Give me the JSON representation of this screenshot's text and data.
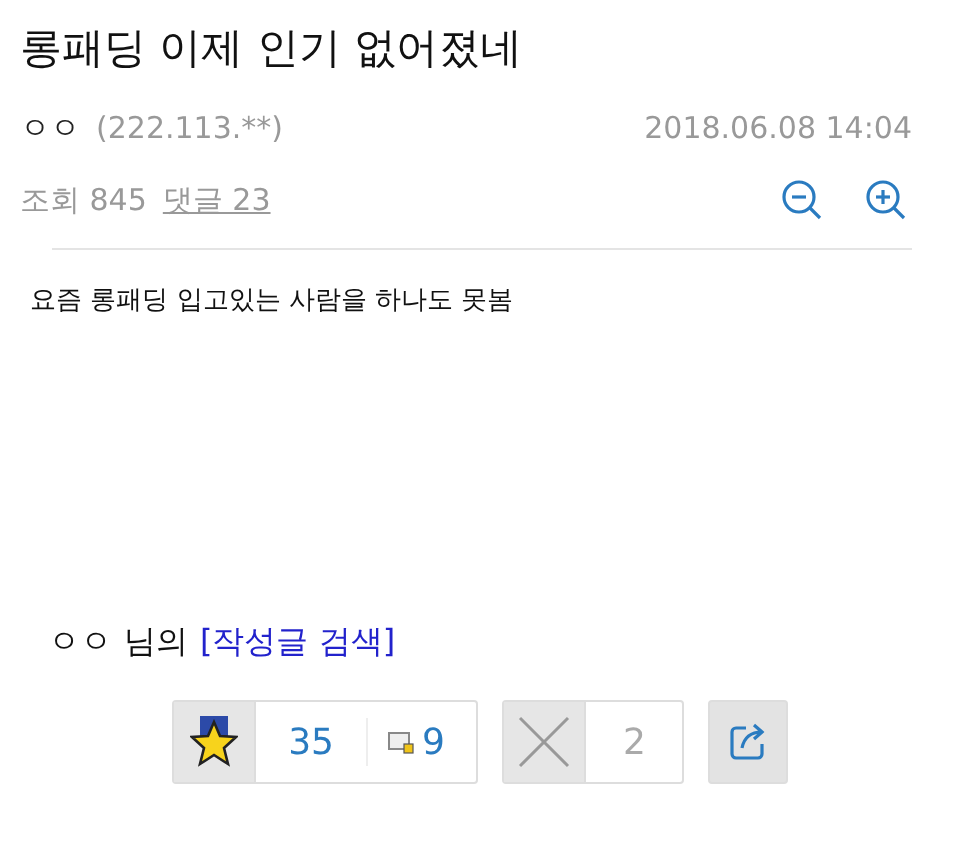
{
  "post": {
    "title": "롱패딩 이제 인기 없어졌네",
    "author": "ㅇㅇ",
    "ip": "(222.113.**)",
    "date": "2018.06.08 14:04",
    "views_label": "조회 845",
    "comments_link": "댓글 23",
    "body": "요즘 롱패딩 입고있는 사람을 하나도 못봄"
  },
  "author_search": {
    "author": "ㅇㅇ",
    "suffix": "님의",
    "link": "[작성글 검색]"
  },
  "actions": {
    "recommend_count": "35",
    "fixed_count": "9",
    "dislike_count": "2"
  }
}
